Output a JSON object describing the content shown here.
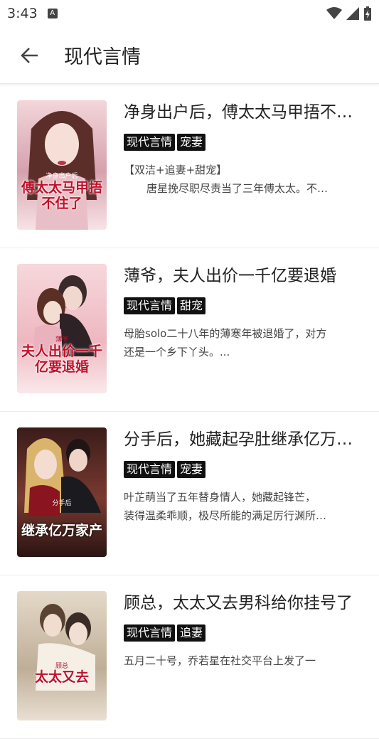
{
  "status_bar": {
    "time": "3:43",
    "notification_letter": "A"
  },
  "app_bar": {
    "title": "现代言情"
  },
  "books": [
    {
      "title": "净身出户后，傅太太马甲捂不住了",
      "tags": [
        "现代言情",
        "宠妻"
      ],
      "desc_line1": "【双洁+追妻+甜宠】",
      "desc_line2": "唐星挽尽职尽责当了三年傅太太。不…",
      "cover_top": "净身出户后",
      "cover_title": "傅太太马甲捂不住了",
      "cover_bg": "#e9b7c0"
    },
    {
      "title": "薄爷，夫人出价一千亿要退婚",
      "tags": [
        "现代言情",
        "甜宠"
      ],
      "desc_line1": "母胎solo二十八年的薄寒年被退婚了，对方",
      "desc_line2": "还是一个乡下丫头。...",
      "cover_top": "薄爷",
      "cover_title": "夫人出价一千亿要退婚",
      "cover_bg": "#f1c9cf"
    },
    {
      "title": "分手后，她藏起孕肚继承亿万家产",
      "tags": [
        "现代言情",
        "宠妻"
      ],
      "desc_line1": "叶芷萌当了五年替身情人，她藏起锋芒，",
      "desc_line2": "装得温柔乖顺，极尽所能的满足厉行渊所…",
      "cover_top": "分手后",
      "cover_title": "继承亿万家产",
      "cover_bg": "#5a2a24"
    },
    {
      "title": "顾总，太太又去男科给你挂号了",
      "tags": [
        "现代言情",
        "追妻"
      ],
      "desc_line1": "五月二十号，乔若星在社交平台上发了一",
      "desc_line2": "",
      "cover_top": "顾总",
      "cover_title": "太太又去",
      "cover_bg": "#d8cbb8"
    }
  ]
}
